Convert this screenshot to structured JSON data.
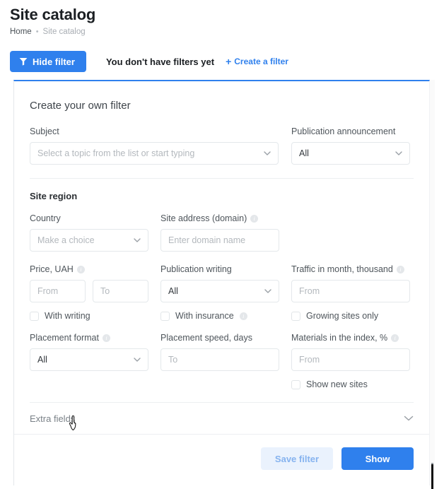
{
  "page": {
    "title": "Site catalog",
    "breadcrumb": {
      "home": "Home",
      "separator": "•",
      "current": "Site catalog"
    }
  },
  "toolbar": {
    "hide_filter_label": "Hide filter",
    "hide_filter_icon": "funnel-icon",
    "no_filters_text": "You don't have filters yet",
    "create_filter_label": "Create a filter",
    "create_filter_icon": "plus-icon"
  },
  "filter_card": {
    "heading": "Create your own filter",
    "fields": {
      "subject": {
        "label": "Subject",
        "placeholder": "Select a topic from the list or start typing",
        "value": ""
      },
      "publication_announcement": {
        "label": "Publication announcement",
        "value": "All"
      }
    },
    "site_region": {
      "title": "Site region",
      "country": {
        "label": "Make a choice",
        "field_label": "Country",
        "placeholder": "Make a choice",
        "value": ""
      },
      "site_address": {
        "field_label": "Site address (domain)",
        "placeholder": "Enter domain name",
        "value": "",
        "info": "info-icon"
      },
      "price": {
        "field_label": "Price, UAH",
        "from_placeholder": "From",
        "to_placeholder": "To",
        "from_value": "",
        "to_value": "",
        "checkbox_label": "With writing",
        "checked": false,
        "info": "info-icon"
      },
      "publication_writing": {
        "field_label": "Publication writing",
        "value": "All",
        "checkbox_label": "With insurance",
        "checked": false,
        "checkbox_info": "info-icon"
      },
      "traffic": {
        "field_label": "Traffic in month, thousand",
        "placeholder": "From",
        "value": "",
        "checkbox_label": "Growing sites only",
        "checked": false,
        "info": "info-icon"
      },
      "placement_format": {
        "field_label": "Placement format",
        "value": "All",
        "info": "info-icon"
      },
      "placement_speed": {
        "field_label": "Placement speed, days",
        "placeholder": "To",
        "value": ""
      },
      "materials_index": {
        "field_label": "Materials in the index, %",
        "placeholder": "From",
        "value": "",
        "checkbox_label": "Show new sites",
        "checked": false,
        "info": "info-icon"
      }
    },
    "extra_fields": {
      "label": "Extra fields",
      "chevron": "chevron-down-icon"
    },
    "actions": {
      "save_label": "Save filter",
      "show_label": "Show"
    }
  },
  "colors": {
    "accent": "#2f80ed",
    "accent_soft": "#eaf2fd",
    "accent_soft_text": "#86b3ef",
    "border": "#e4e8eb",
    "divider": "#eceff1",
    "placeholder": "#b3b8bd",
    "label": "#4e555b",
    "muted": "#a8adb3"
  }
}
